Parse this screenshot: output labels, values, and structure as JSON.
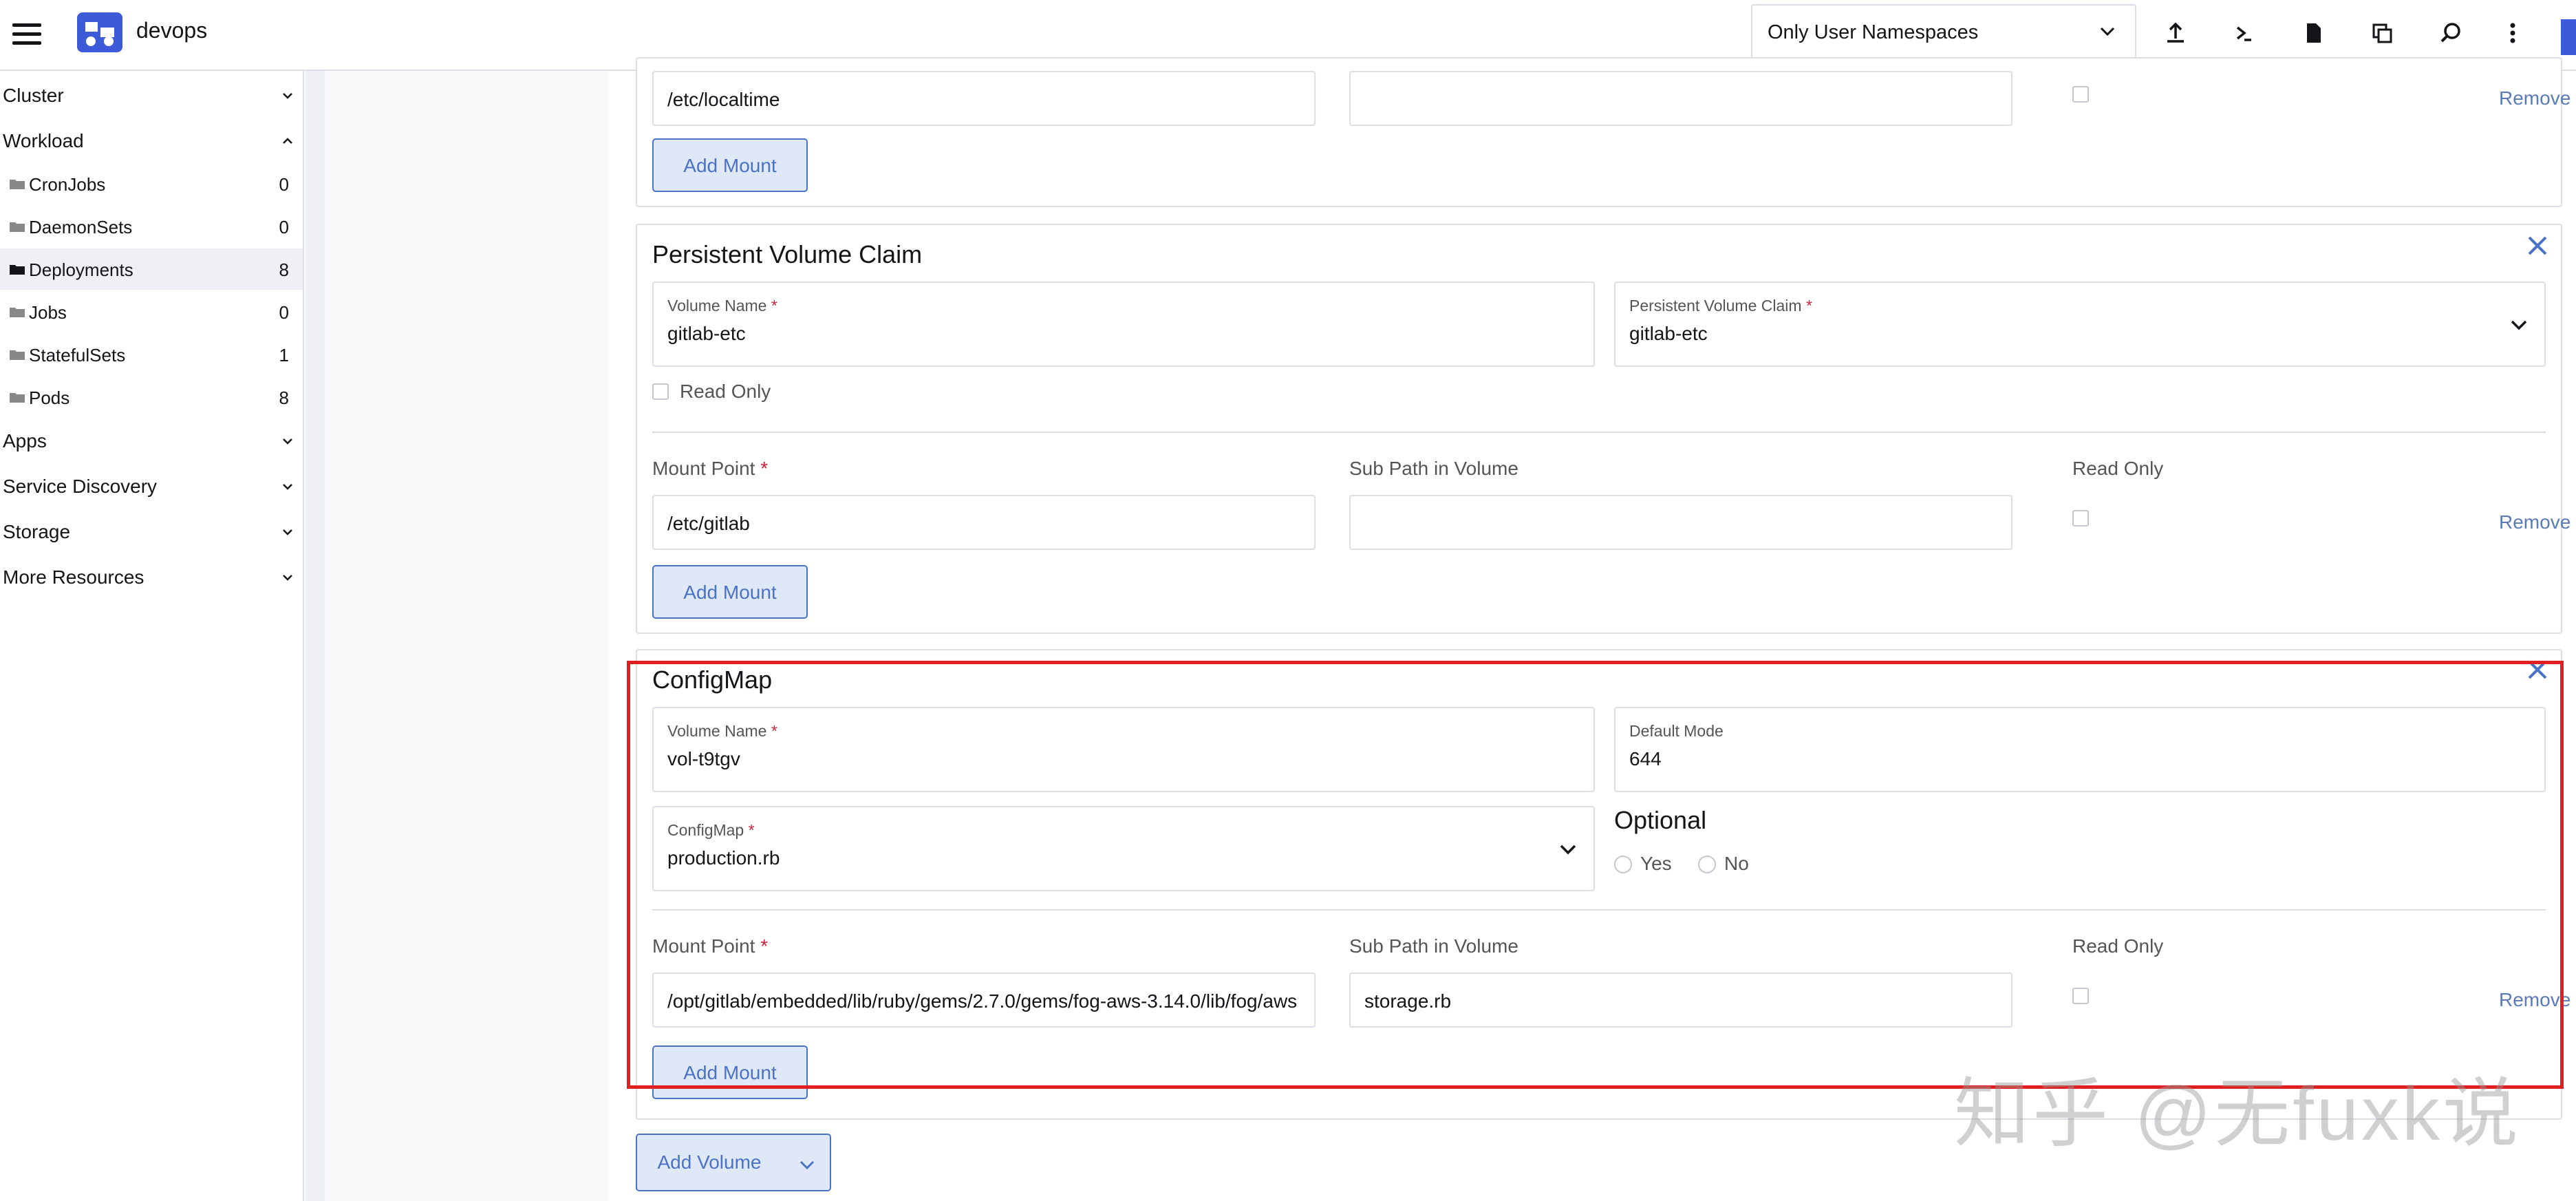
{
  "header": {
    "brand": "devops",
    "namespace_filter": "Only User Namespaces",
    "icons": [
      "upload-icon",
      "terminal-icon",
      "file-icon",
      "copy-icon",
      "search-icon",
      "more-vertical-icon"
    ]
  },
  "sidebar": {
    "groups": [
      "Cluster",
      "Workload",
      "Apps",
      "Service Discovery",
      "Storage",
      "More Resources"
    ],
    "workload_items": [
      {
        "label": "CronJobs",
        "count": "0"
      },
      {
        "label": "DaemonSets",
        "count": "0"
      },
      {
        "label": "Deployments",
        "count": "8"
      },
      {
        "label": "Jobs",
        "count": "0"
      },
      {
        "label": "StatefulSets",
        "count": "1"
      },
      {
        "label": "Pods",
        "count": "8"
      }
    ]
  },
  "top_card": {
    "mount_point_value": "/etc/localtime",
    "remove": "Remove",
    "add_mount": "Add Mount"
  },
  "pvc_card": {
    "title": "Persistent Volume Claim",
    "volume_name_label": "Volume Name",
    "volume_name_value": "gitlab-etc",
    "pvc_label": "Persistent Volume Claim",
    "pvc_value": "gitlab-etc",
    "read_only_checkbox": "Read Only",
    "mount_point_label": "Mount Point",
    "sub_path_label": "Sub Path in Volume",
    "read_only_label": "Read Only",
    "mount_point_value": "/etc/gitlab",
    "sub_path_value": "",
    "remove": "Remove",
    "add_mount": "Add Mount"
  },
  "configmap_card": {
    "title": "ConfigMap",
    "volume_name_label": "Volume Name",
    "volume_name_value": "vol-t9tgv",
    "default_mode_label": "Default Mode",
    "default_mode_value": "644",
    "configmap_label": "ConfigMap",
    "configmap_value": "production.rb",
    "optional_label": "Optional",
    "yes": "Yes",
    "no": "No",
    "mount_point_label": "Mount Point",
    "sub_path_label": "Sub Path in Volume",
    "read_only_label": "Read Only",
    "mount_point_value": "/opt/gitlab/embedded/lib/ruby/gems/2.7.0/gems/fog-aws-3.14.0/lib/fog/aws",
    "sub_path_value": "storage.rb",
    "remove": "Remove",
    "add_mount": "Add Mount"
  },
  "add_volume": "Add Volume",
  "watermark": "知乎 @无fuxk说",
  "colors": {
    "accent": "#3d5bd9",
    "link": "#5a7ab8",
    "highlight": "#e02020",
    "required": "#d0243a"
  }
}
